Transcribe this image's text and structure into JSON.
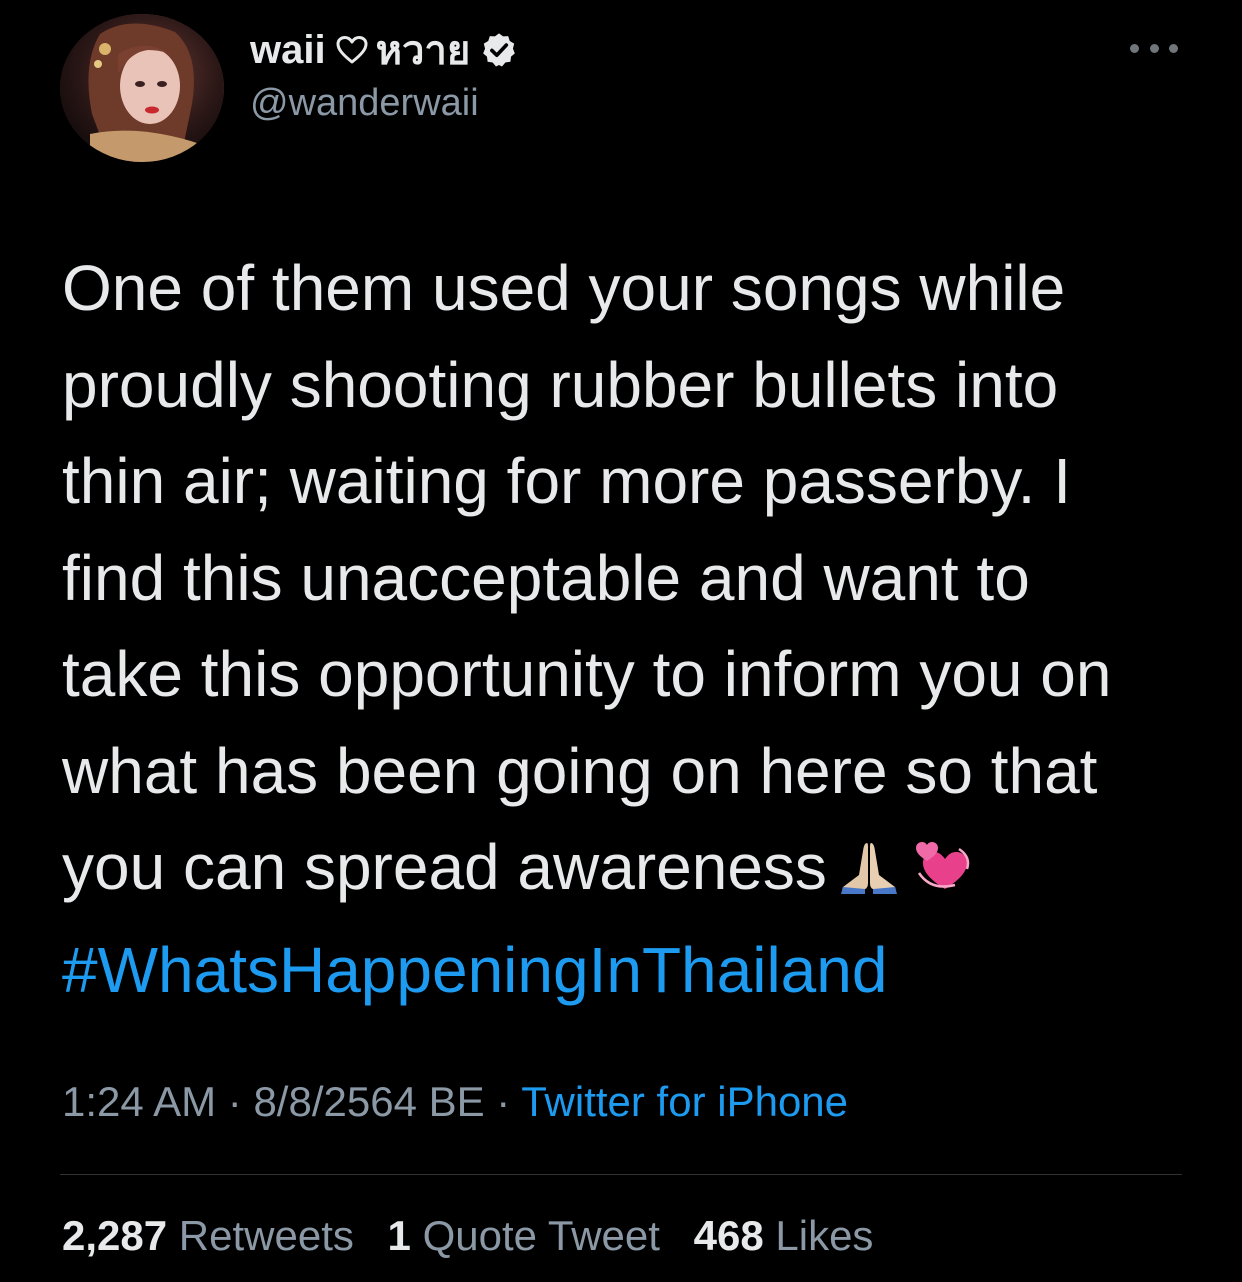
{
  "author": {
    "display_name": "waii",
    "display_name_suffix": "หวาย",
    "handle": "@wanderwaii",
    "verified_icon": "verified-badge-icon",
    "heart_icon": "heart-outline-icon"
  },
  "tweet": {
    "lines": [
      "One of them used your songs while",
      "proudly shooting rubber bullets into",
      "thin air; waiting for more passerby. I",
      "find this unacceptable and want to",
      "take this opportunity to inform you on",
      "what has been going on here so that",
      "you can spread awareness"
    ],
    "emojis": [
      "praying-hands-emoji",
      "revolving-hearts-emoji"
    ],
    "hashtag": "#WhatsHappeningInThailand"
  },
  "meta": {
    "time": "1:24 AM",
    "separator": " · ",
    "date": "8/8/2564 BE",
    "source": "Twitter for iPhone"
  },
  "stats": {
    "retweets_count": "2,287",
    "retweets_label": "Retweets",
    "quotes_count": "1",
    "quotes_label": "Quote Tweet",
    "likes_count": "468",
    "likes_label": "Likes"
  },
  "colors": {
    "background": "#000000",
    "text": "#e7e9ea",
    "secondary": "#8b98a5",
    "accent": "#1d9bf0"
  }
}
